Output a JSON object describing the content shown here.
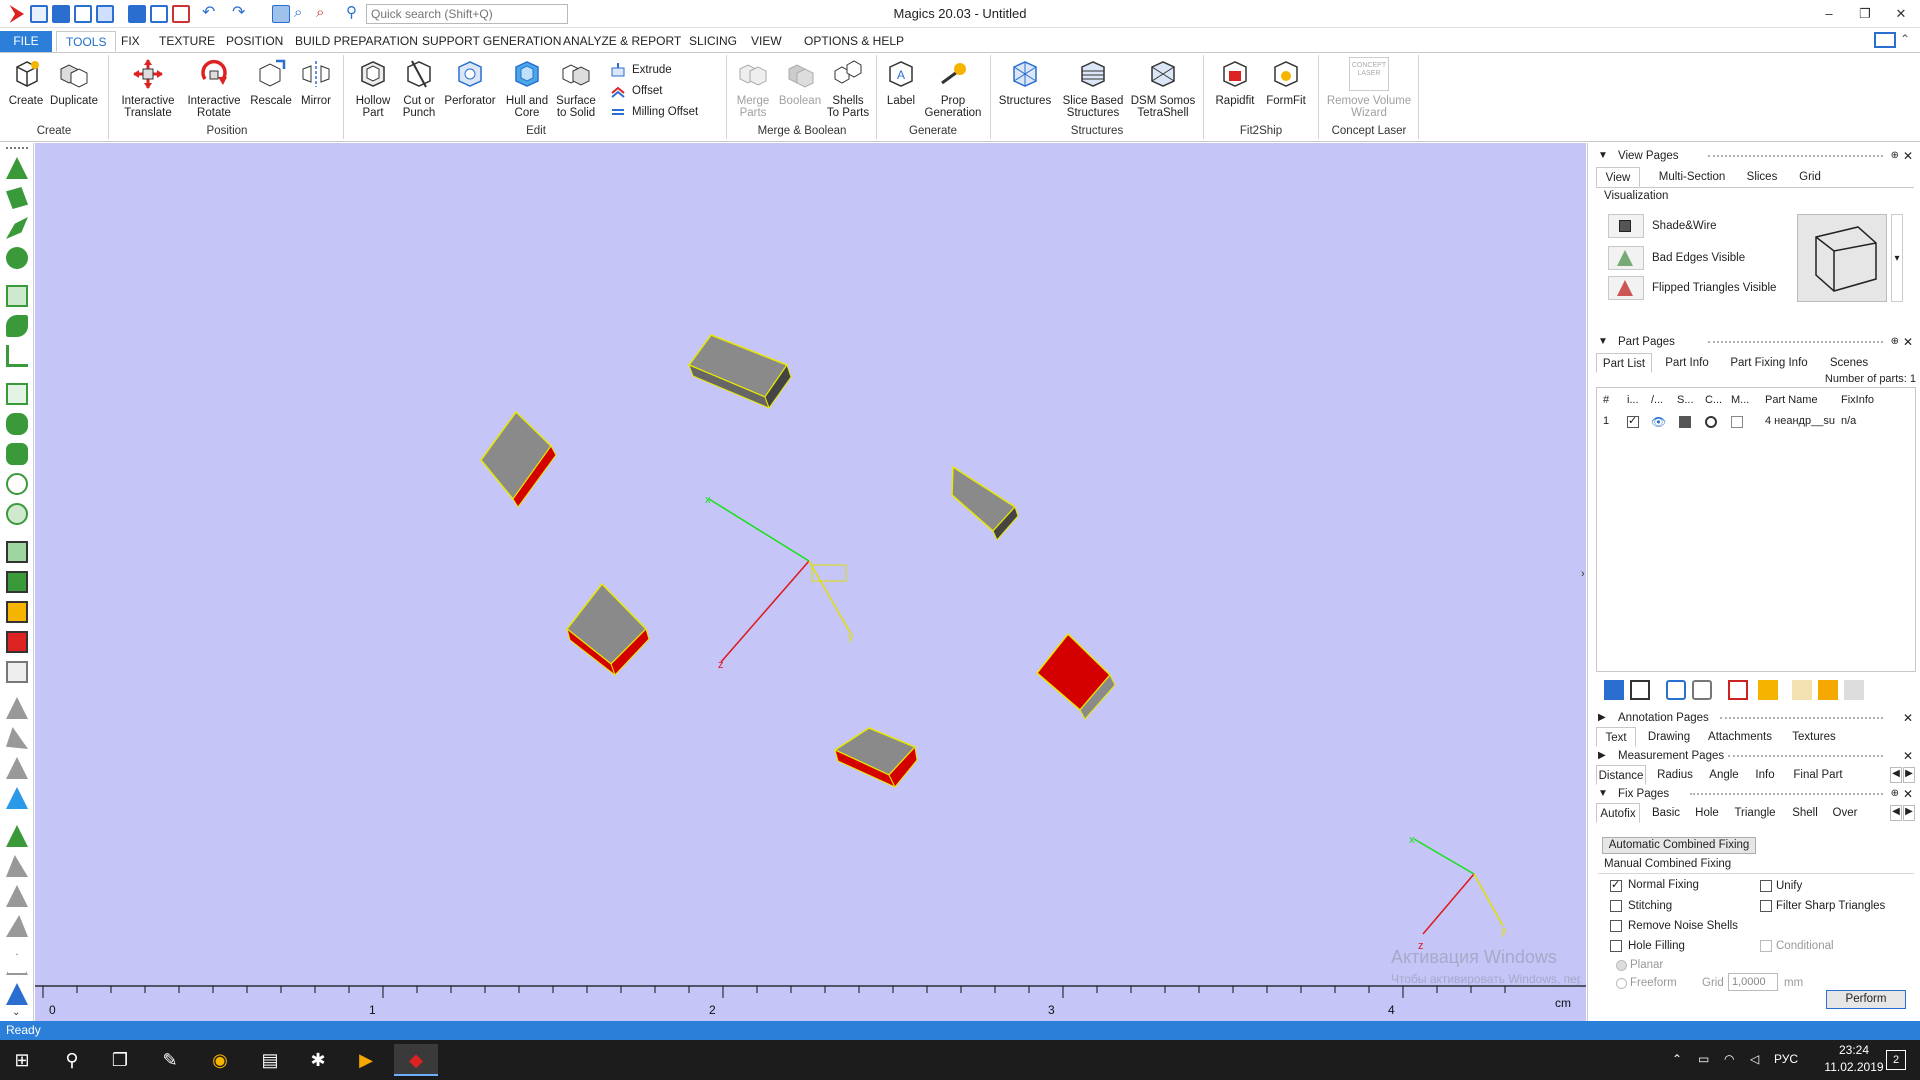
{
  "title_bar": {
    "app_title": "Magics 20.03 - Untitled",
    "search_placeholder": "Quick search (Shift+Q)"
  },
  "ribbon_tabs": [
    "FILE",
    "TOOLS",
    "FIX",
    "TEXTURE",
    "POSITION",
    "BUILD PREPARATION",
    "SUPPORT GENERATION",
    "ANALYZE & REPORT",
    "SLICING",
    "VIEW",
    "OPTIONS & HELP"
  ],
  "active_tab": "TOOLS",
  "ribbon": {
    "create": {
      "label": "Create",
      "create": "Create",
      "duplicate": "Duplicate"
    },
    "position": {
      "label": "Position",
      "translate_1": "Interactive",
      "translate_2": "Translate",
      "rotate_1": "Interactive",
      "rotate_2": "Rotate",
      "rescale": "Rescale",
      "mirror": "Mirror"
    },
    "edit": {
      "label": "Edit",
      "hollow_1": "Hollow",
      "hollow_2": "Part",
      "cut_1": "Cut or",
      "cut_2": "Punch",
      "perforator": "Perforator",
      "hull_1": "Hull and",
      "hull_2": "Core",
      "surface_1": "Surface",
      "surface_2": "to Solid",
      "extrude": "Extrude",
      "offset": "Offset",
      "milling_offset": "Milling Offset"
    },
    "merge": {
      "label": "Merge & Boolean",
      "merge_1": "Merge",
      "merge_2": "Parts",
      "boolean": "Boolean",
      "shells_1": "Shells",
      "shells_2": "To Parts"
    },
    "generate": {
      "label": "Generate",
      "label_btn": "Label",
      "prop_1": "Prop",
      "prop_2": "Generation"
    },
    "structures": {
      "label": "Structures",
      "structures": "Structures",
      "slice_1": "Slice Based",
      "slice_2": "Structures",
      "dsm_1": "DSM Somos",
      "dsm_2": "TetraShell"
    },
    "fit2ship": {
      "label": "Fit2Ship",
      "rapidfit": "Rapidfit",
      "formfit": "FormFit"
    },
    "concept_laser": {
      "label": "Concept Laser",
      "remove_1": "Remove Volume",
      "remove_2": "Wizard",
      "logo_text": "CONCEPT LASER"
    }
  },
  "viewport": {
    "ruler_ticks": [
      "0",
      "1",
      "2",
      "3",
      "4"
    ],
    "ruler_unit": "cm",
    "axis_x": "x",
    "axis_y": "y",
    "axis_z": "z",
    "watermark_1": "Активация Windows",
    "watermark_2": "Чтобы активировать Windows, перейдите в раздел \"Параметры\"."
  },
  "view_pages": {
    "title": "View Pages",
    "tabs": [
      "View",
      "Multi-Section",
      "Slices",
      "Grid"
    ],
    "visualization": "Visualization",
    "items": [
      "Shade&Wire",
      "Bad Edges Visible",
      "Flipped Triangles Visible"
    ]
  },
  "part_pages": {
    "title": "Part Pages",
    "tabs": [
      "Part List",
      "Part Info",
      "Part Fixing Info",
      "Scenes"
    ],
    "number_of_parts": "Number of parts: 1",
    "columns": [
      "#",
      "i...",
      "/...",
      "S...",
      "C...",
      "M...",
      "Part Name",
      "FixInfo"
    ],
    "rows": [
      {
        "num": "1",
        "name": "4 неандр__su",
        "fixinfo": "n/a"
      }
    ]
  },
  "annotation_pages": {
    "title": "Annotation Pages",
    "tabs": [
      "Text",
      "Drawing",
      "Attachments",
      "Textures"
    ]
  },
  "measurement_pages": {
    "title": "Measurement Pages",
    "tabs": [
      "Distance",
      "Radius",
      "Angle",
      "Info",
      "Final Part"
    ]
  },
  "fix_pages": {
    "title": "Fix Pages",
    "tabs": [
      "Autofix",
      "Basic",
      "Hole",
      "Triangle",
      "Shell",
      "Over"
    ],
    "auto_button": "Automatic Combined Fixing",
    "manual_title": "Manual Combined Fixing",
    "normal_fixing": "Normal Fixing",
    "unify": "Unify",
    "stitching": "Stitching",
    "filter_sharp": "Filter Sharp Triangles",
    "remove_noise": "Remove Noise Shells",
    "hole_filling": "Hole Filling",
    "conditional": "Conditional",
    "planar": "Planar",
    "freeform": "Freeform",
    "grid_label": "Grid",
    "grid_value": "1,0000",
    "grid_unit": "mm",
    "perform": "Perform"
  },
  "status": {
    "text": "Ready"
  },
  "taskbar": {
    "lang": "РУС",
    "time": "23:24",
    "date": "11.02.2019",
    "notif": "2"
  }
}
